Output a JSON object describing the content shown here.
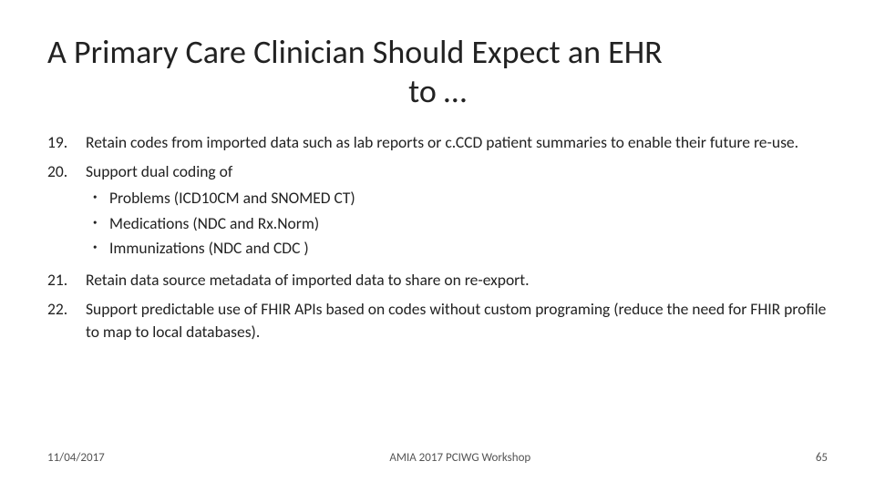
{
  "title": {
    "line1": "A Primary Care Clinician Should Expect an EHR",
    "line2": "to …"
  },
  "items": [
    {
      "number": "19.",
      "text": "Retain codes from imported data such as lab reports or c.CCD patient summaries to enable their future re-use."
    },
    {
      "number": "20.",
      "text": "Support dual coding of"
    },
    {
      "number": "21.",
      "text": "Retain data source metadata of imported data to share on re-export."
    },
    {
      "number": "22.",
      "text": "Support predictable use of FHIR APIs based on codes without custom programing (reduce the need for FHIR profile to map to local databases)."
    }
  ],
  "subItems": [
    "Problems (ICD10CM and SNOMED CT)",
    "Medications (NDC and Rx.Norm)",
    "Immunizations (NDC and CDC )"
  ],
  "footer": {
    "date": "11/04/2017",
    "workshop": "AMIA 2017 PCIWG Workshop",
    "page": "65"
  }
}
